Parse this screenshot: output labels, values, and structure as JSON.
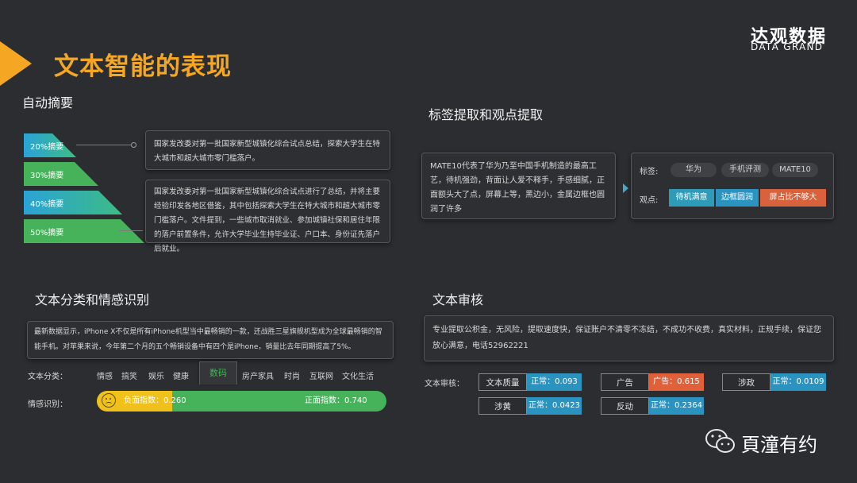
{
  "header": {
    "title": "文本智能的表现",
    "logo_cn": "达观数据",
    "logo_en": "DATA GRAND"
  },
  "summary": {
    "heading": "自动摘要",
    "levels": [
      {
        "label": "20%摘要"
      },
      {
        "label": "30%摘要"
      },
      {
        "label": "40%摘要"
      },
      {
        "label": "50%摘要"
      }
    ],
    "text_short": "国家发改委对第一批国家新型城镇化综合试点总结，探索大学生在特大城市和超大城市零门槛落户。",
    "text_long": "国家发改委对第一批国家新型城镇化综合试点进行了总结，并将主要经验印发各地区借鉴，其中包括探索大学生在特大城市和超大城市零门槛落户。文件提到，一些城市取消就业、参加城镇社保和居住年限的落户前置条件，允许大学毕业生持毕业证、户口本、身份证先落户后就业。"
  },
  "tagging": {
    "heading": "标签提取和观点提取",
    "source_text": "MATE10代表了华为乃至中国手机制造的最高工艺，待机强劲，背面让人爱不释手，手感细腻，正面额头大了点，屏幕上等，黑边小，金属边框也圆润了许多",
    "tags_label": "标签:",
    "tags": [
      "华为",
      "手机评测",
      "MATE10"
    ],
    "opinions_label": "观点:",
    "opinions": [
      {
        "text": "待机满意",
        "color": "#2e9bb8"
      },
      {
        "text": "边框圆润",
        "color": "#2a93c0"
      },
      {
        "text": "屏占比不够大",
        "color": "#d9613b"
      }
    ]
  },
  "classify": {
    "heading": "文本分类和情感识别",
    "source_text": "最新数据显示，iPhone X不仅是所有iPhone机型当中最畅销的一款，还战胜三星旗舰机型成为全球最畅销的智能手机。对苹果来说，今年第二个月的五个畅销设备中有四个是iPhone，销量比去年同期提高了5%。",
    "category_label": "文本分类：",
    "categories": [
      "情感",
      "搞笑",
      "娱乐",
      "健康",
      "数码",
      "房产家具",
      "时尚",
      "互联网",
      "文化生活"
    ],
    "selected_category": "数码",
    "sentiment_label": "情感识别：",
    "negative_label": "负面指数：0.260",
    "positive_label": "正面指数：0.740",
    "negative_value": 0.26,
    "positive_value": 0.74,
    "negative_color": "#f0c11a",
    "positive_color": "#46b35a"
  },
  "audit": {
    "heading": "文本审核",
    "source_text": "专业提取公积金，无风险，提取速度快，保证账户不清零不冻结，不成功不收费，真实材料，正规手续，保证您放心满意，电话52962221",
    "label": "文本审核：",
    "items": [
      {
        "name": "文本质量",
        "value": "正常：0.093",
        "color": "#2a93c0"
      },
      {
        "name": "广告",
        "value": "广告：0.615",
        "color": "#e0603a"
      },
      {
        "name": "涉政",
        "value": "正常：0.0109",
        "color": "#2a93c0"
      },
      {
        "name": "涉黄",
        "value": "正常：0.0423",
        "color": "#2a93c0"
      },
      {
        "name": "反动",
        "value": "正常：0.2364",
        "color": "#2a93c0"
      }
    ]
  },
  "watermark": {
    "text": "頁潼有约"
  }
}
